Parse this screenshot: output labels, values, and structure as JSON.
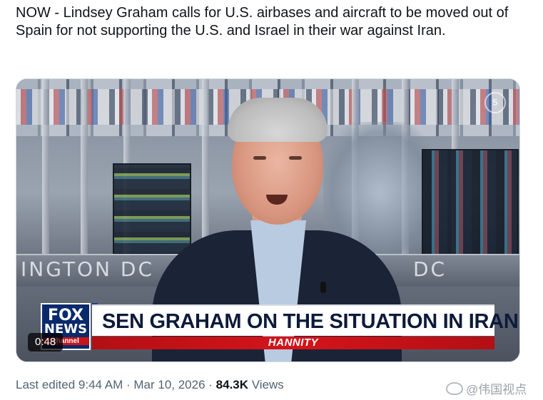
{
  "tweet": {
    "text": "NOW - Lindsey Graham calls for U.S. airbases and aircraft to be moved out of Spain for not supporting the U.S. and Israel in their war against Iran."
  },
  "video": {
    "chyron_headline": "SEN GRAHAM ON THE SITUATION IN IRAN",
    "chyron_show": "HANNITY",
    "logo_line1": "FOX",
    "logo_line2": "NEWS",
    "logo_line3": "channel",
    "studio_sign_left": "INGTON DC",
    "studio_sign_right": "DC",
    "duration": "0:48"
  },
  "meta": {
    "edited": "Last edited 9:44 AM · Mar 10, 2026 · ",
    "views_count": "84.3K",
    "views_label": " Views"
  },
  "watermark": {
    "text": "@伟国视点"
  }
}
